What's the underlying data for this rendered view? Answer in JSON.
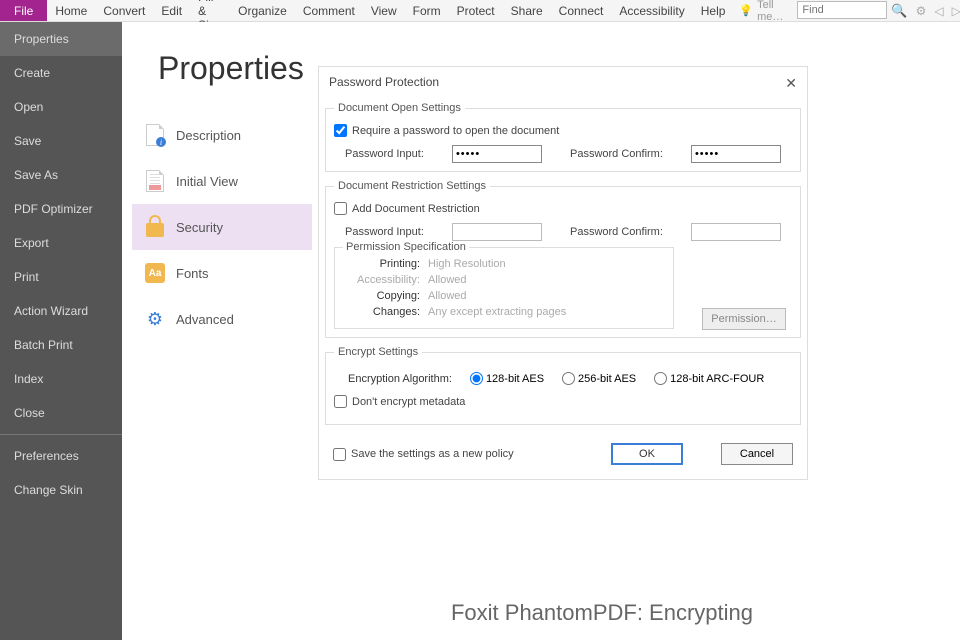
{
  "menubar": {
    "file": "File",
    "items": [
      "Home",
      "Convert",
      "Edit",
      "Fill & Sign",
      "Organize",
      "Comment",
      "View",
      "Form",
      "Protect",
      "Share",
      "Connect",
      "Accessibility",
      "Help"
    ],
    "tell_me": "Tell me…",
    "find_placeholder": "Find"
  },
  "sidebar": {
    "items": [
      "Properties",
      "Create",
      "Open",
      "Save",
      "Save As",
      "PDF Optimizer",
      "Export",
      "Print",
      "Action Wizard",
      "Batch Print",
      "Index",
      "Close"
    ],
    "items2": [
      "Preferences",
      "Change Skin"
    ],
    "selected": 0
  },
  "page_title": "Properties",
  "tabs": [
    {
      "label": "Description",
      "icon": "doc-info"
    },
    {
      "label": "Initial View",
      "icon": "doc-view"
    },
    {
      "label": "Security",
      "icon": "lock"
    },
    {
      "label": "Fonts",
      "icon": "font"
    },
    {
      "label": "Advanced",
      "icon": "gear"
    }
  ],
  "tabs_active": 2,
  "dialog": {
    "title": "Password Protection",
    "open_settings": {
      "legend": "Document Open Settings",
      "require_label": "Require a password to open the document",
      "require_checked": true,
      "pw_input_label": "Password Input:",
      "pw_confirm_label": "Password Confirm:",
      "pw_value": "•••••",
      "pw_confirm_value": "•••••"
    },
    "restrict": {
      "legend": "Document Restriction Settings",
      "add_label": "Add Document Restriction",
      "add_checked": false,
      "pw_input_label": "Password Input:",
      "pw_confirm_label": "Password Confirm:",
      "perm_legend": "Permission Specification",
      "perm": {
        "printing_l": "Printing:",
        "printing_v": "High Resolution",
        "acc_l": "Accessibility:",
        "acc_v": "Allowed",
        "copy_l": "Copying:",
        "copy_v": "Allowed",
        "chg_l": "Changes:",
        "chg_v": "Any except extracting pages"
      },
      "perm_btn": "Permission…"
    },
    "encrypt": {
      "legend": "Encrypt Settings",
      "algo_label": "Encryption Algorithm:",
      "opts": [
        "128-bit AES",
        "256-bit AES",
        "128-bit ARC-FOUR"
      ],
      "selected": 0,
      "no_meta": "Don't encrypt metadata"
    },
    "save_policy": "Save the settings as a new policy",
    "ok": "OK",
    "cancel": "Cancel"
  },
  "caption": "Foxit PhantomPDF: Encrypting"
}
